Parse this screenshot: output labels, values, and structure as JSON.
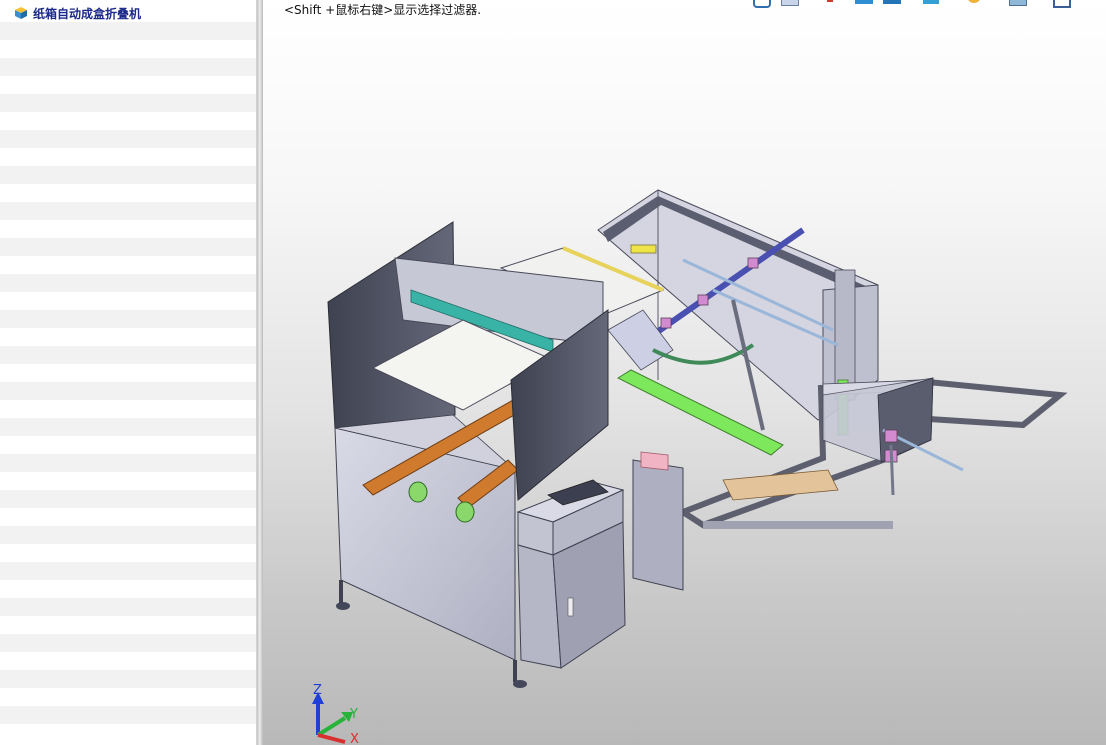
{
  "feature_tree": {
    "root_label": "纸箱自动成盒折叠机",
    "root_icon": "part-cube-icon",
    "empty_rows": 40
  },
  "viewport": {
    "hint_text": "<Shift +鼠标右键>显示选择过滤器.",
    "hud_icons": [
      "rotate-view-icon",
      "sheet-icon",
      "pen-icon",
      "view-cube-icon",
      "shaded-cube-icon",
      "display-style-icon",
      "lamp-icon",
      "scene-icon",
      "section-icon"
    ],
    "triad": {
      "z": "Z",
      "y": "Y",
      "x": "X"
    }
  },
  "colors": {
    "tree_title": "#1b2a8a",
    "machine_frame": "#c9cad8",
    "machine_dark": "#4e5160",
    "belt_orange": "#cf7a2c",
    "accent_green": "#7de85c",
    "accent_teal": "#36b3a7"
  }
}
